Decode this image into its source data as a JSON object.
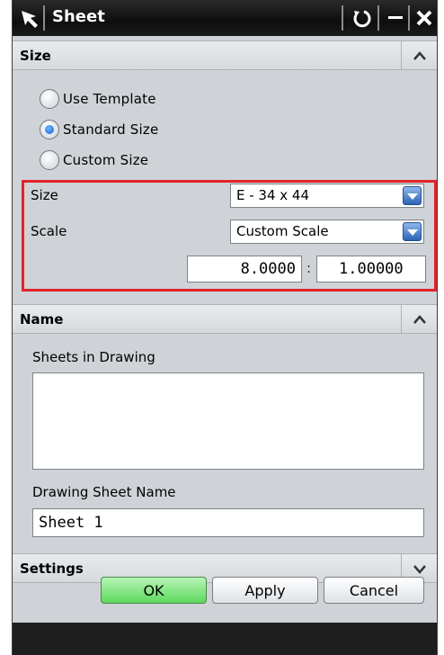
{
  "window": {
    "title": "Sheet",
    "icons": [
      "select-arrow-icon",
      "reset-icon",
      "minimize-icon",
      "close-icon"
    ]
  },
  "size_group": {
    "header": "Size",
    "radio_options": [
      {
        "label": "Use Template",
        "checked": false
      },
      {
        "label": "Standard Size",
        "checked": true
      },
      {
        "label": "Custom Size",
        "checked": false
      }
    ],
    "size_label": "Size",
    "size_value": "E - 34 x 44",
    "scale_label": "Scale",
    "scale_value": "Custom Scale",
    "scale_numerator": "8.0000",
    "scale_separator": ":",
    "scale_denominator": "1.00000"
  },
  "name_group": {
    "header": "Name",
    "sheets_label": "Sheets in Drawing",
    "sheet_name_label": "Drawing Sheet Name",
    "sheet_name_value": "Sheet 1"
  },
  "settings_group": {
    "header": "Settings"
  },
  "buttons": {
    "ok": "OK",
    "apply": "Apply",
    "cancel": "Cancel"
  },
  "colors": {
    "highlight": "#e0242a",
    "ok_button": "#5ed85e",
    "dropdown": "#2d64b6"
  }
}
